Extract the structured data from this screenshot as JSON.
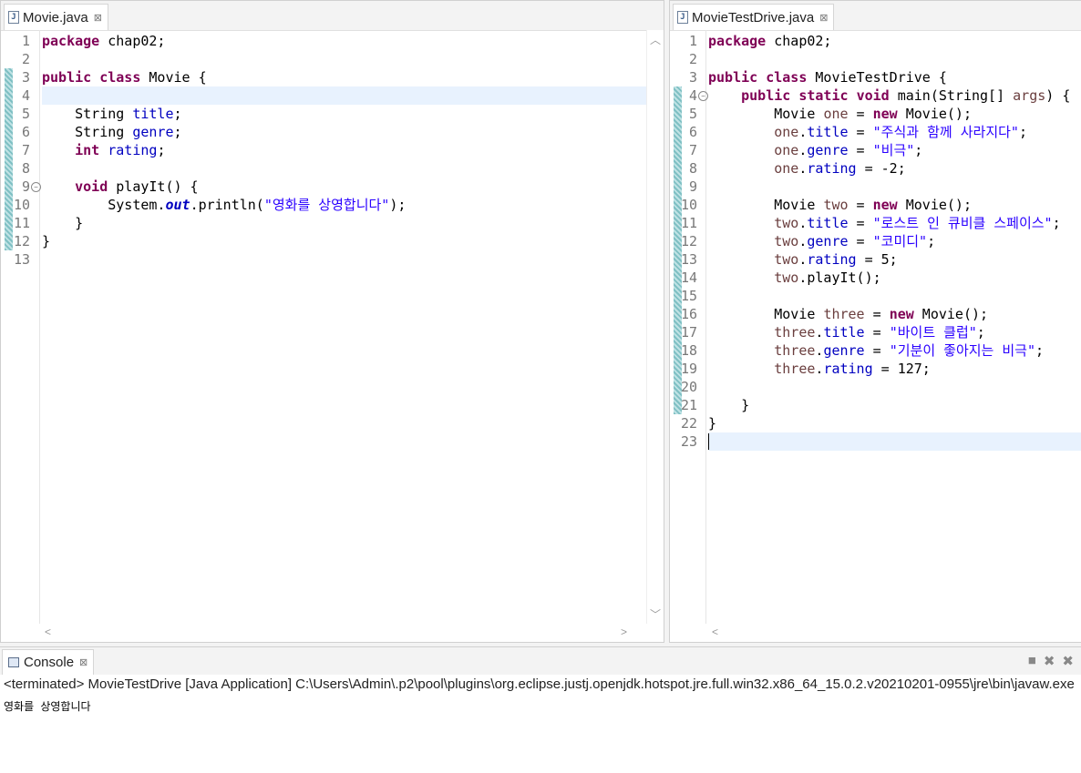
{
  "editor_left": {
    "tab": {
      "icon": "java-file-icon",
      "label": "Movie.java",
      "close": "⊠"
    }
  },
  "editor_right": {
    "tab": {
      "icon": "java-file-icon",
      "label": "MovieTestDrive.java",
      "close": "⊠"
    }
  },
  "console": {
    "tab_label": "Console",
    "status": "<terminated> MovieTestDrive [Java Application] C:\\Users\\Admin\\.p2\\pool\\plugins\\org.eclipse.justj.openjdk.hotspot.jre.full.win32.x86_64_15.0.2.v20210201-0955\\jre\\bin\\javaw.exe",
    "output": "영화를 상영합니다",
    "tools": [
      "terminate-icon",
      "remove-launch-icon",
      "remove-all-terminated-icon"
    ]
  },
  "movie_code": [
    [
      [
        "k",
        "package"
      ],
      [
        "t",
        " chap02;"
      ]
    ],
    [],
    [
      [
        "k",
        "public"
      ],
      [
        "t",
        " "
      ],
      [
        "k",
        "class"
      ],
      [
        "t",
        " Movie {"
      ]
    ],
    [],
    [
      [
        "t",
        "    String "
      ],
      [
        "f",
        "title"
      ],
      [
        "t",
        ";"
      ]
    ],
    [
      [
        "t",
        "    String "
      ],
      [
        "f",
        "genre"
      ],
      [
        "t",
        ";"
      ]
    ],
    [
      [
        "t",
        "    "
      ],
      [
        "k",
        "int"
      ],
      [
        "t",
        " "
      ],
      [
        "f",
        "rating"
      ],
      [
        "t",
        ";"
      ]
    ],
    [],
    [
      [
        "t",
        "    "
      ],
      [
        "k",
        "void"
      ],
      [
        "t",
        " playIt() {"
      ]
    ],
    [
      [
        "t",
        "        System."
      ],
      [
        "sf",
        "out"
      ],
      [
        "t",
        ".println("
      ],
      [
        "s",
        "\"영화를 상영합니다\""
      ],
      [
        "t",
        ");"
      ]
    ],
    [
      [
        "t",
        "    }"
      ]
    ],
    [
      [
        "t",
        "}"
      ]
    ],
    []
  ],
  "test_code": [
    [
      [
        "k",
        "package"
      ],
      [
        "t",
        " chap02;"
      ]
    ],
    [],
    [
      [
        "k",
        "public"
      ],
      [
        "t",
        " "
      ],
      [
        "k",
        "class"
      ],
      [
        "t",
        " MovieTestDrive {"
      ]
    ],
    [
      [
        "t",
        "    "
      ],
      [
        "k",
        "public"
      ],
      [
        "t",
        " "
      ],
      [
        "k",
        "static"
      ],
      [
        "t",
        " "
      ],
      [
        "k",
        "void"
      ],
      [
        "t",
        " main(String[] "
      ],
      [
        "l",
        "args"
      ],
      [
        "t",
        ") {"
      ]
    ],
    [
      [
        "t",
        "        Movie "
      ],
      [
        "l",
        "one"
      ],
      [
        "t",
        " = "
      ],
      [
        "k",
        "new"
      ],
      [
        "t",
        " Movie();"
      ]
    ],
    [
      [
        "t",
        "        "
      ],
      [
        "l",
        "one"
      ],
      [
        "t",
        "."
      ],
      [
        "f",
        "title"
      ],
      [
        "t",
        " = "
      ],
      [
        "s",
        "\"주식과 함께 사라지다\""
      ],
      [
        "t",
        ";"
      ]
    ],
    [
      [
        "t",
        "        "
      ],
      [
        "l",
        "one"
      ],
      [
        "t",
        "."
      ],
      [
        "f",
        "genre"
      ],
      [
        "t",
        " = "
      ],
      [
        "s",
        "\"비극\""
      ],
      [
        "t",
        ";"
      ]
    ],
    [
      [
        "t",
        "        "
      ],
      [
        "l",
        "one"
      ],
      [
        "t",
        "."
      ],
      [
        "f",
        "rating"
      ],
      [
        "t",
        " = -2;"
      ]
    ],
    [],
    [
      [
        "t",
        "        Movie "
      ],
      [
        "l",
        "two"
      ],
      [
        "t",
        " = "
      ],
      [
        "k",
        "new"
      ],
      [
        "t",
        " Movie();"
      ]
    ],
    [
      [
        "t",
        "        "
      ],
      [
        "l",
        "two"
      ],
      [
        "t",
        "."
      ],
      [
        "f",
        "title"
      ],
      [
        "t",
        " = "
      ],
      [
        "s",
        "\"로스트 인 큐비클 스페이스\""
      ],
      [
        "t",
        ";"
      ]
    ],
    [
      [
        "t",
        "        "
      ],
      [
        "l",
        "two"
      ],
      [
        "t",
        "."
      ],
      [
        "f",
        "genre"
      ],
      [
        "t",
        " = "
      ],
      [
        "s",
        "\"코미디\""
      ],
      [
        "t",
        ";"
      ]
    ],
    [
      [
        "t",
        "        "
      ],
      [
        "l",
        "two"
      ],
      [
        "t",
        "."
      ],
      [
        "f",
        "rating"
      ],
      [
        "t",
        " = 5;"
      ]
    ],
    [
      [
        "t",
        "        "
      ],
      [
        "l",
        "two"
      ],
      [
        "t",
        ".playIt();"
      ]
    ],
    [],
    [
      [
        "t",
        "        Movie "
      ],
      [
        "l",
        "three"
      ],
      [
        "t",
        " = "
      ],
      [
        "k",
        "new"
      ],
      [
        "t",
        " Movie();"
      ]
    ],
    [
      [
        "t",
        "        "
      ],
      [
        "l",
        "three"
      ],
      [
        "t",
        "."
      ],
      [
        "f",
        "title"
      ],
      [
        "t",
        " = "
      ],
      [
        "s",
        "\"바이트 클럽\""
      ],
      [
        "t",
        ";"
      ]
    ],
    [
      [
        "t",
        "        "
      ],
      [
        "l",
        "three"
      ],
      [
        "t",
        "."
      ],
      [
        "f",
        "genre"
      ],
      [
        "t",
        " = "
      ],
      [
        "s",
        "\"기분이 좋아지는 비극\""
      ],
      [
        "t",
        ";"
      ]
    ],
    [
      [
        "t",
        "        "
      ],
      [
        "l",
        "three"
      ],
      [
        "t",
        "."
      ],
      [
        "f",
        "rating"
      ],
      [
        "t",
        " = 127;"
      ]
    ],
    [],
    [
      [
        "t",
        "    }"
      ]
    ],
    [
      [
        "t",
        "}"
      ]
    ],
    []
  ],
  "movie_highlight_line": 4,
  "movie_fold_lines": [
    9
  ],
  "movie_changed_lines": [
    3,
    12
  ],
  "test_highlight_line": 23,
  "test_fold_lines": [
    4
  ],
  "test_changed_lines": [
    4,
    21
  ],
  "colors": {
    "keyword": "#7f0055",
    "field": "#0000c0",
    "string": "#2a00ff",
    "local": "#6a3e3e",
    "current_line": "#e8f2fe"
  }
}
